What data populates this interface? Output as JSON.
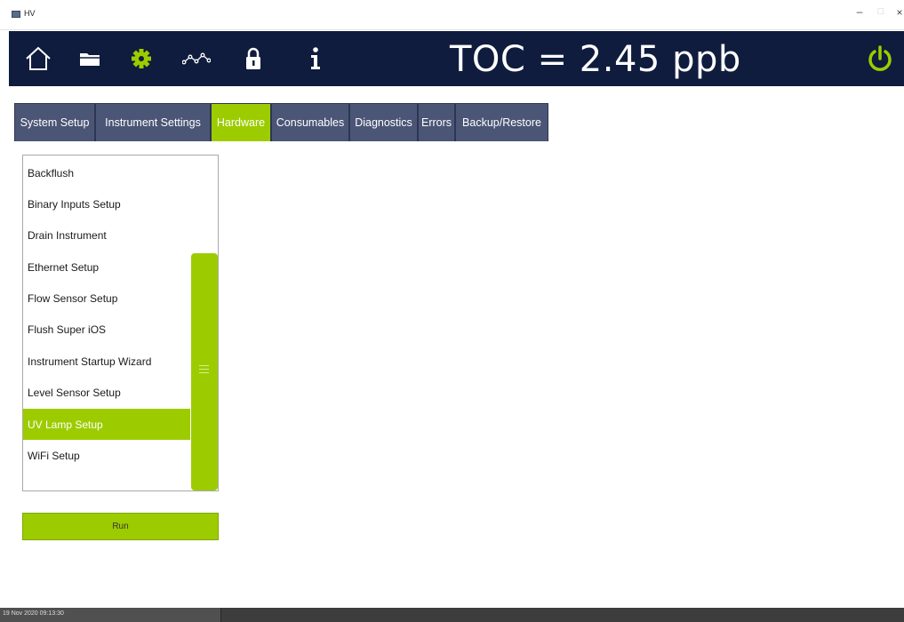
{
  "window": {
    "title": "HV",
    "controls": {
      "minimize": "–",
      "maximize": "□",
      "close": "×"
    }
  },
  "toolbar": {
    "icons": [
      "home-icon",
      "folder-icon",
      "gear-icon",
      "trend-icon",
      "lock-icon",
      "info-icon"
    ],
    "reading": "TOC = 2.45 ppb",
    "power_icon": "power-icon",
    "colors": {
      "background": "#0f1c3d",
      "accent": "#9ccc00"
    }
  },
  "tabs": [
    {
      "label": "System Setup",
      "active": false
    },
    {
      "label": "Instrument Settings",
      "active": false
    },
    {
      "label": "Hardware",
      "active": true
    },
    {
      "label": "Consumables",
      "active": false
    },
    {
      "label": "Diagnostics",
      "active": false
    },
    {
      "label": "Errors",
      "active": false
    },
    {
      "label": "Backup/Restore",
      "active": false
    }
  ],
  "list": {
    "items": [
      {
        "label": "Backflush"
      },
      {
        "label": "Binary Inputs Setup"
      },
      {
        "label": "Drain Instrument"
      },
      {
        "label": "Ethernet Setup"
      },
      {
        "label": "Flow Sensor Setup"
      },
      {
        "label": "Flush Super iOS"
      },
      {
        "label": "Instrument Startup Wizard"
      },
      {
        "label": "Level Sensor Setup"
      },
      {
        "label": "UV Lamp Setup"
      },
      {
        "label": "WiFi Setup"
      }
    ],
    "selected": "UV Lamp Setup"
  },
  "actions": {
    "run_label": "Run"
  },
  "status": {
    "timestamp": "19 Nov 2020  09:13:30"
  }
}
